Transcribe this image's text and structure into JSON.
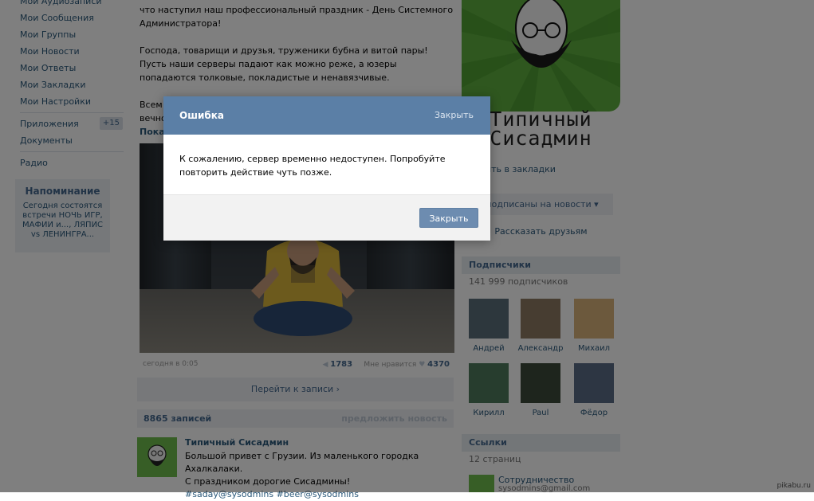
{
  "leftnav": {
    "items_top": [
      {
        "label": "Мои Аудиозаписи"
      },
      {
        "label": "Мои Сообщения"
      },
      {
        "label": "Мои Группы"
      },
      {
        "label": "Мои Новости"
      },
      {
        "label": "Мои Ответы"
      },
      {
        "label": "Мои Закладки"
      },
      {
        "label": "Мои Настройки"
      }
    ],
    "apps_label": "Приложения",
    "apps_badge": "+15",
    "docs_label": "Документы",
    "radio_label": "Радио"
  },
  "reminder": {
    "title": "Напоминание",
    "text": "Сегодня состоятся встречи НОЧЬ ИГР, МАФИИ и..., ЛЯПИС vs ЛЕНИНГРА..."
  },
  "post": {
    "para1": "что наступил наш профессиональный праздник - День Системного Администратора!",
    "para2": "Господа, товарищи и друзья, труженики бубна и витой пары! Пусть наши серверы падают как можно реже, а юзеры попадаются толковые, покладистые и ненавязчивые.",
    "para3_start": "Всем п",
    "para3_line2": "вечно",
    "show_more": "Пока",
    "date": "сегодня в 0:05",
    "reposts": "1783",
    "likes_label": "Мне нравится",
    "likes": "4370"
  },
  "wall": {
    "next_label": "Перейти к записи ›",
    "count": "8865 записей",
    "suggest": "предложить новость",
    "post": {
      "author": "Типичный Сисадмин",
      "line1": "Большой привет с Грузии. Из маленького городка Ахалкалаки.",
      "line2": "С праздником дорогие Сисадмины!",
      "tags": "#saday@sysodmins #beer@sysodmins"
    }
  },
  "right": {
    "logo_line1": "Типичный",
    "logo_line2": "Сисадмин",
    "bookmark": "ить в закладки",
    "subscribe": "ы подписаны на новости ▾",
    "tell_friends": "Рассказать друзьям",
    "subscribers": {
      "title": "Подписчики",
      "count": "141 999 подписчиков",
      "members": [
        {
          "name": "Андрей",
          "color": "#5a6e7a"
        },
        {
          "name": "Александр",
          "color": "#8f7b62"
        },
        {
          "name": "Михаил",
          "color": "#d8b27a"
        },
        {
          "name": "Кирилл",
          "color": "#4f7a5c"
        },
        {
          "name": "Paul",
          "color": "#3c4a3a"
        },
        {
          "name": "Фёдор",
          "color": "#5a6d86"
        }
      ]
    },
    "links": {
      "title": "Ссылки",
      "count": "12 страниц",
      "item_title": "Сотрудничество",
      "item_url": "sysodmins@gmail.com"
    }
  },
  "watermark": "pikabu.ru",
  "dialog": {
    "title": "Ошибка",
    "close_link": "Закрыть",
    "message": "К сожалению, сервер временно недоступен. Попробуйте повторить действие чуть позже.",
    "button": "Закрыть"
  }
}
